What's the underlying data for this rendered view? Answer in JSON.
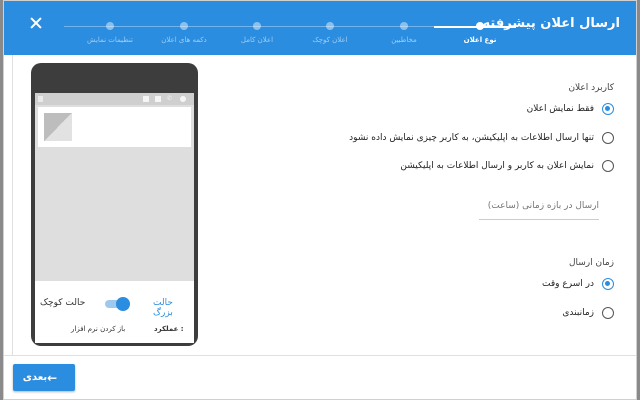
{
  "header": {
    "title": "ارسال اعلان پیشرفته"
  },
  "steps": [
    {
      "label": "نوع اعلان",
      "active": true
    },
    {
      "label": "مخاطبین",
      "active": false
    },
    {
      "label": "اعلان کوچک",
      "active": false
    },
    {
      "label": "اعلان کامل",
      "active": false
    },
    {
      "label": "دکمه های اعلان",
      "active": false
    },
    {
      "label": "تنظیمات نمایش",
      "active": false
    }
  ],
  "preview": {
    "mode_large": "حالت بزرگ",
    "mode_small": "حالت کوچک",
    "action_label": "عملکرد :",
    "action_value": "باز کردن نرم افزار"
  },
  "usage": {
    "title": "کاربرد اعلان",
    "options": [
      {
        "label": "فقط نمایش اعلان",
        "selected": true
      },
      {
        "label": "تنها ارسال اطلاعات به اپلیکیشن، به کاربر چیزی نمایش داده نشود",
        "selected": false
      },
      {
        "label": "نمایش اعلان به کاربر و ارسال اطلاعات به اپلیکیشن",
        "selected": false
      }
    ],
    "duration_placeholder": "ارسال در بازه زمانی (ساعت)"
  },
  "send_time": {
    "title": "زمان ارسال",
    "options": [
      {
        "label": "در اسرع وقت",
        "selected": true
      },
      {
        "label": "زمانبندی",
        "selected": false
      }
    ]
  },
  "footer": {
    "next_label": "بعدی"
  },
  "colors": {
    "accent": "#2b8de0"
  }
}
